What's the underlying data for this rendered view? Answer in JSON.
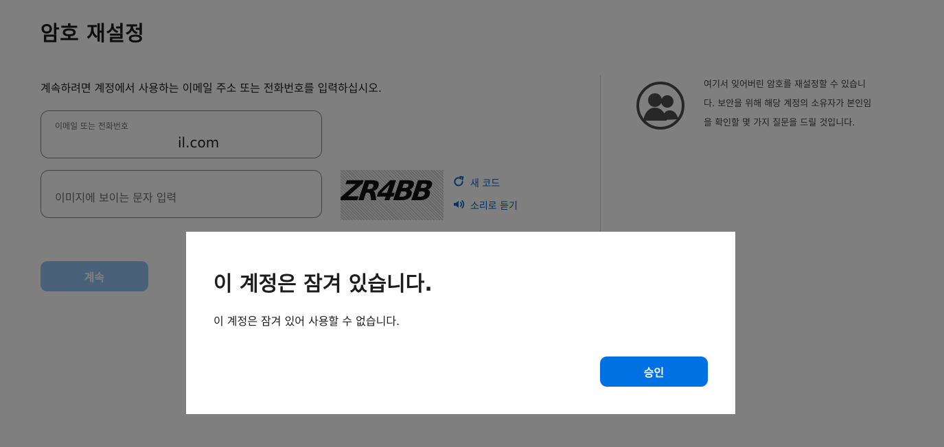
{
  "page": {
    "title": "암호 재설정",
    "instruction": "계속하려면 계정에서 사용하는 이메일 주소 또는 전화번호를 입력하십시오."
  },
  "email_field": {
    "label": "이메일 또는 전화번호",
    "visible_suffix": "il.com"
  },
  "captcha": {
    "placeholder": "이미지에 보이는 문자 입력",
    "image_text": "ZR4BB",
    "new_code_label": "새 코드",
    "audio_label": "소리로 듣기"
  },
  "buttons": {
    "continue_label": "계속",
    "approve_label": "승인"
  },
  "help": {
    "text": "여기서 잊어버린 암호를 재설정할 수 있습니다. 보안을 위해 해당 계정의 소유자가 본인임을 확인할 몇 가지 질문을 드릴 것입니다."
  },
  "modal": {
    "title": "이 계정은 잠겨 있습니다.",
    "message": "이 계정은 잠겨 있어 사용할 수 없습니다."
  },
  "colors": {
    "accent": "#0071e3",
    "link": "#0066cc",
    "overlay": "#808080"
  },
  "icons": {
    "refresh": "refresh-icon",
    "audio": "speaker-icon",
    "help": "people-icon"
  }
}
